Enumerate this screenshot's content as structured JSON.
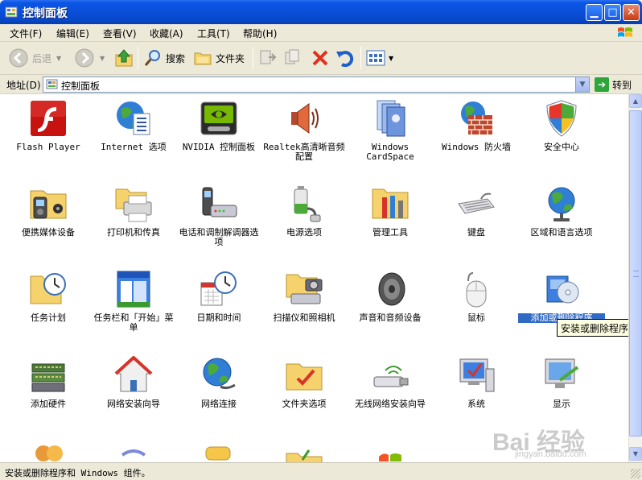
{
  "window": {
    "title": "控制面板"
  },
  "menu": {
    "items": [
      {
        "label": "文件(F)"
      },
      {
        "label": "编辑(E)"
      },
      {
        "label": "查看(V)"
      },
      {
        "label": "收藏(A)"
      },
      {
        "label": "工具(T)"
      },
      {
        "label": "帮助(H)"
      }
    ]
  },
  "toolbar": {
    "back": "后退",
    "search": "搜索",
    "folders": "文件夹"
  },
  "address": {
    "label": "地址(D)",
    "value": "控制面板",
    "go": "转到"
  },
  "items": [
    {
      "label": "Flash Player",
      "icon": "flash-player-icon"
    },
    {
      "label": "Internet 选项",
      "icon": "internet-options-icon"
    },
    {
      "label": "NVIDIA 控制面板",
      "icon": "nvidia-icon"
    },
    {
      "label": "Realtek高清晰音频配置",
      "icon": "realtek-audio-icon"
    },
    {
      "label": "Windows CardSpace",
      "icon": "cardspace-icon"
    },
    {
      "label": "Windows 防火墙",
      "icon": "firewall-icon"
    },
    {
      "label": "安全中心",
      "icon": "security-center-icon"
    },
    {
      "label": "便携媒体设备",
      "icon": "portable-media-icon"
    },
    {
      "label": "打印机和传真",
      "icon": "printer-fax-icon"
    },
    {
      "label": "电话和调制解调器选项",
      "icon": "phone-modem-icon"
    },
    {
      "label": "电源选项",
      "icon": "power-options-icon"
    },
    {
      "label": "管理工具",
      "icon": "admin-tools-icon"
    },
    {
      "label": "键盘",
      "icon": "keyboard-icon"
    },
    {
      "label": "区域和语言选项",
      "icon": "region-language-icon"
    },
    {
      "label": "任务计划",
      "icon": "scheduled-tasks-icon"
    },
    {
      "label": "任务栏和「开始」菜单",
      "icon": "taskbar-start-icon"
    },
    {
      "label": "日期和时间",
      "icon": "date-time-icon"
    },
    {
      "label": "扫描仪和照相机",
      "icon": "scanner-camera-icon"
    },
    {
      "label": "声音和音频设备",
      "icon": "sound-audio-icon"
    },
    {
      "label": "鼠标",
      "icon": "mouse-icon"
    },
    {
      "label": "添加或删除程序",
      "icon": "add-remove-programs-icon"
    },
    {
      "label": "添加硬件",
      "icon": "add-hardware-icon"
    },
    {
      "label": "网络安装向导",
      "icon": "network-setup-icon"
    },
    {
      "label": "网络连接",
      "icon": "network-connections-icon"
    },
    {
      "label": "文件夹选项",
      "icon": "folder-options-icon"
    },
    {
      "label": "无线网络安装向导",
      "icon": "wireless-setup-icon"
    },
    {
      "label": "系统",
      "icon": "system-icon"
    },
    {
      "label": "显示",
      "icon": "display-icon"
    }
  ],
  "tooltip": "安装或删除程序和",
  "status": "安装或删除程序和 Windows 组件。",
  "watermark": {
    "brand": "Bai 经验",
    "url": "jingyan.baidu.com"
  }
}
